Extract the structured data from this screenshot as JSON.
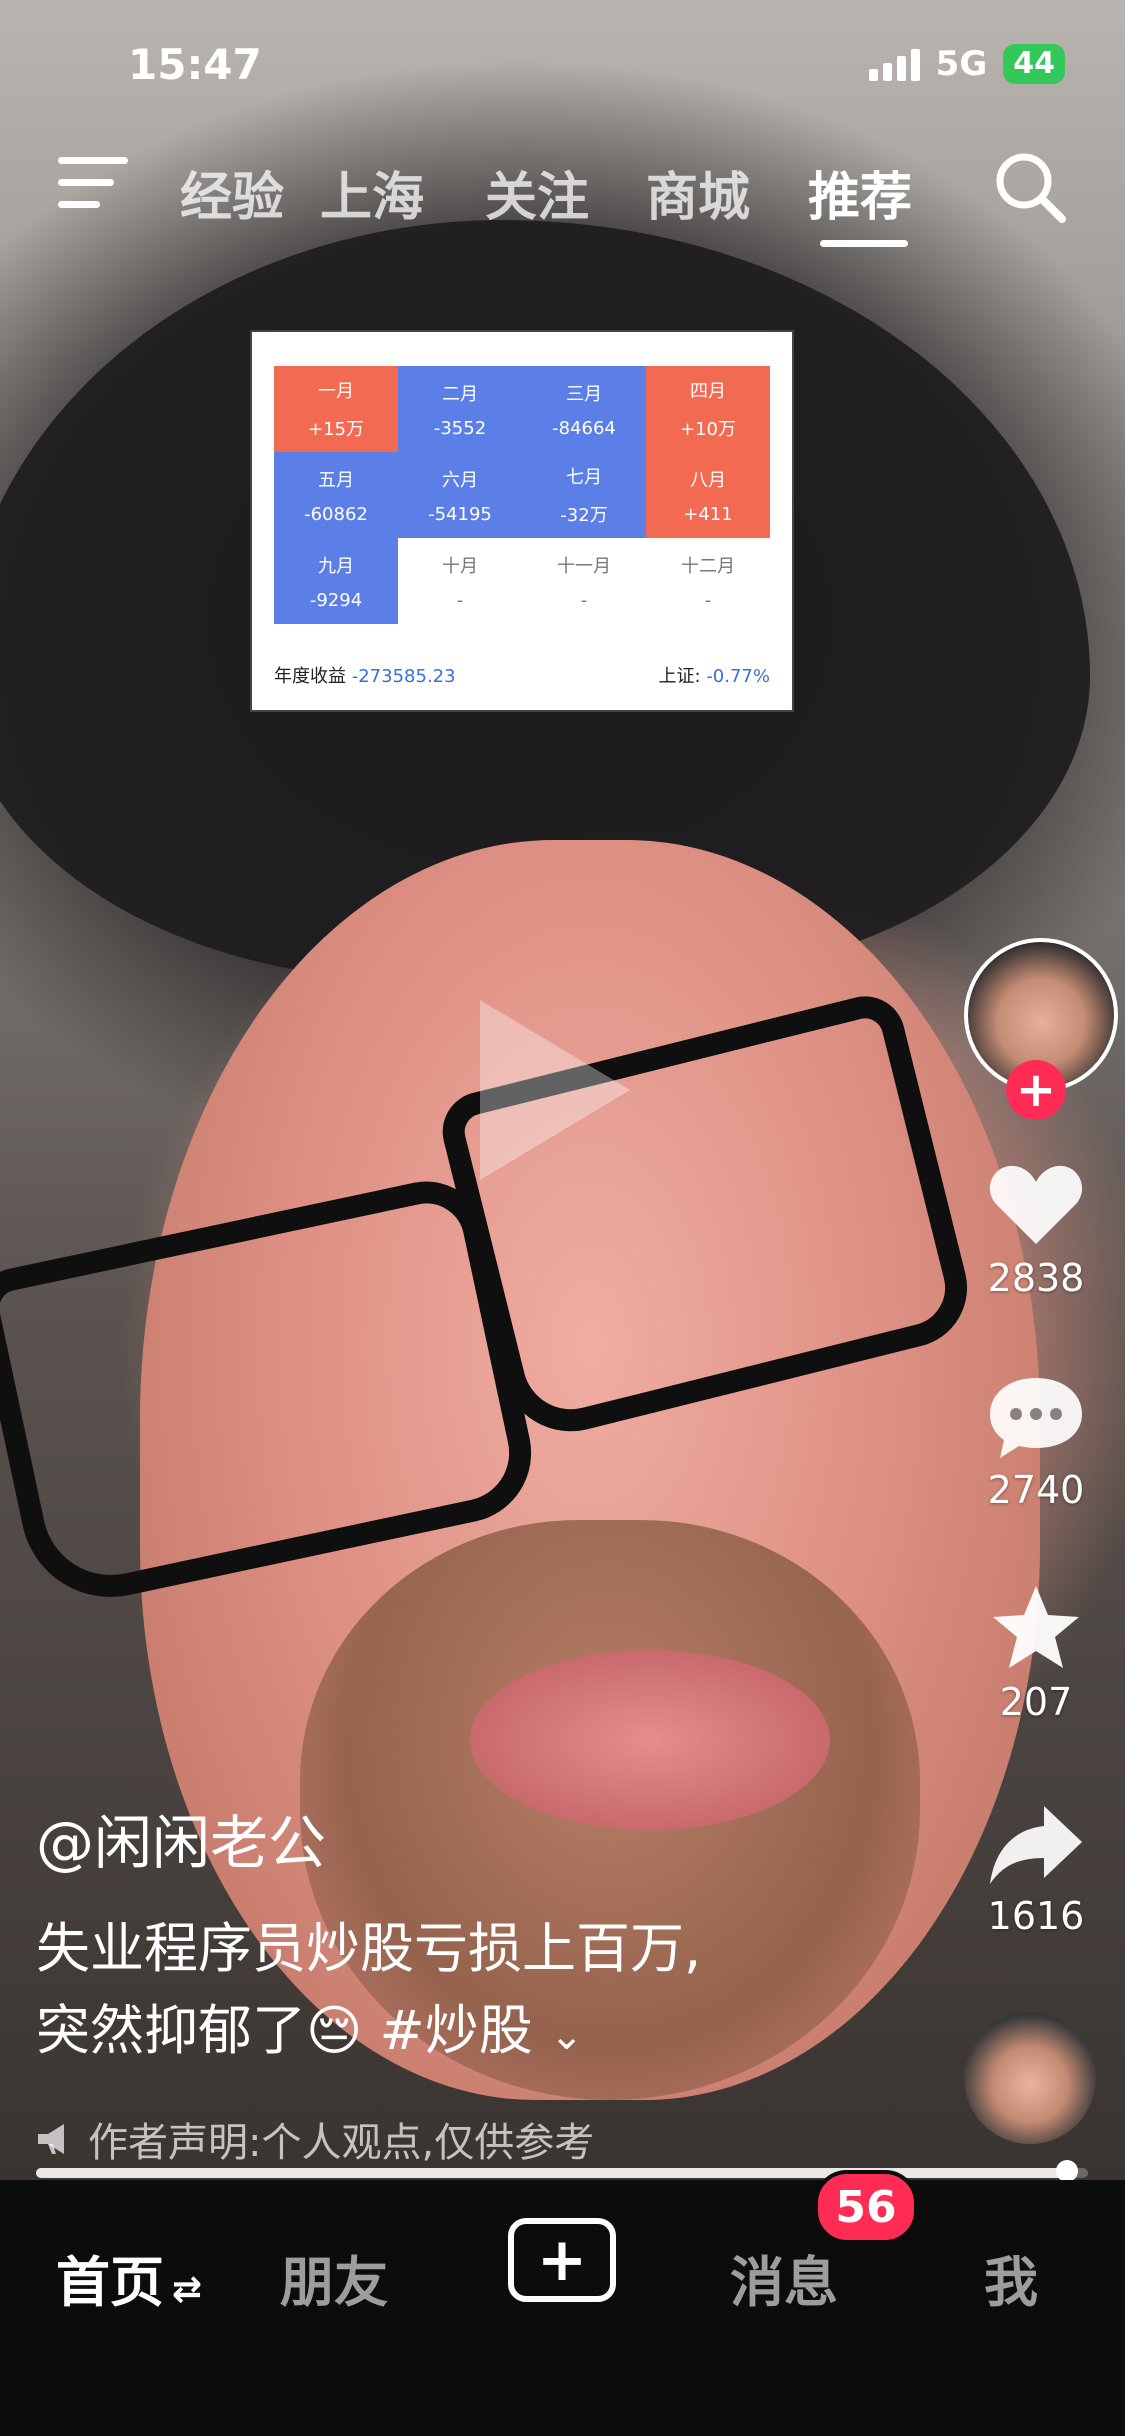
{
  "status_bar": {
    "time": "15:47",
    "network": "5G",
    "battery": "44"
  },
  "top_nav": {
    "tabs": [
      {
        "label": "经验",
        "active": false
      },
      {
        "label": "上海",
        "active": false
      },
      {
        "label": "关注",
        "active": false
      },
      {
        "label": "商城",
        "active": false
      },
      {
        "label": "推荐",
        "active": true
      }
    ]
  },
  "overlay_table": {
    "cells": [
      {
        "month": "一月",
        "value": "+15万",
        "color": "red"
      },
      {
        "month": "二月",
        "value": "-3552",
        "color": "blue"
      },
      {
        "month": "三月",
        "value": "-84664",
        "color": "blue"
      },
      {
        "month": "四月",
        "value": "+10万",
        "color": "red"
      },
      {
        "month": "五月",
        "value": "-60862",
        "color": "blue"
      },
      {
        "month": "六月",
        "value": "-54195",
        "color": "blue"
      },
      {
        "month": "七月",
        "value": "-32万",
        "color": "blue"
      },
      {
        "month": "八月",
        "value": "+411",
        "color": "red"
      },
      {
        "month": "九月",
        "value": "-9294",
        "color": "blue"
      },
      {
        "month": "十月",
        "value": "-",
        "color": "empty"
      },
      {
        "month": "十一月",
        "value": "-",
        "color": "empty"
      },
      {
        "month": "十二月",
        "value": "-",
        "color": "empty"
      }
    ],
    "annual_label": "年度收益",
    "annual_value": "-273585.23",
    "index_label": "上证:",
    "index_value": "-0.77%"
  },
  "actions": {
    "likes": "2838",
    "comments": "2740",
    "favorites": "207",
    "shares": "1616"
  },
  "post": {
    "author": "@闲闲老公",
    "caption_line1": "失业程序员炒股亏损上百万,",
    "caption_line2": "突然抑郁了😔 #炒股",
    "disclaimer": "作者声明:个人观点,仅供参考"
  },
  "progress": {
    "fraction": 0.98
  },
  "bottom_nav": {
    "home": "首页",
    "friends": "朋友",
    "messages": "消息",
    "messages_badge": "56",
    "me": "我"
  },
  "colors": {
    "accent": "#fe2c55",
    "table_red": "#f26a52",
    "table_blue": "#5b7fe6"
  }
}
